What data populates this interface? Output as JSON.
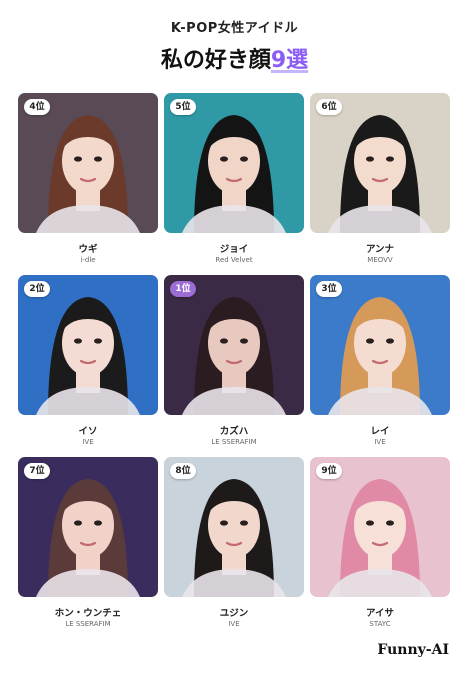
{
  "header": {
    "subtitle": "K-POP女性アイドル",
    "title_main": "私の好き顔",
    "title_accent": "9選"
  },
  "cards": [
    {
      "rank": "4位",
      "name": "ウギ",
      "group": "i-dle",
      "bg": "#5a4a55",
      "hair": "#6b3a2a",
      "skin": "#f2d9cc"
    },
    {
      "rank": "5位",
      "name": "ジョイ",
      "group": "Red Velvet",
      "bg": "#2f9aa6",
      "hair": "#141414",
      "skin": "#f1d6c8"
    },
    {
      "rank": "6位",
      "name": "アンナ",
      "group": "MEOVV",
      "bg": "#d9d2c6",
      "hair": "#1a1a1a",
      "skin": "#f3dccd"
    },
    {
      "rank": "2位",
      "name": "イソ",
      "group": "IVE",
      "bg": "#2f6fc4",
      "hair": "#1b1b1b",
      "skin": "#f4dcd4"
    },
    {
      "rank": "1位",
      "name": "カズハ",
      "group": "LE SSERAFIM",
      "bg": "#3a2a45",
      "hair": "#2a1c20",
      "skin": "#e8c9c0"
    },
    {
      "rank": "3位",
      "name": "レイ",
      "group": "IVE",
      "bg": "#3b7bc9",
      "hair": "#d59a5a",
      "skin": "#f4ddd0"
    },
    {
      "rank": "7位",
      "name": "ホン・ウンチェ",
      "group": "LE SSERAFIM",
      "bg": "#3a2d5e",
      "hair": "#5b3a3a",
      "skin": "#f0d2c8"
    },
    {
      "rank": "8位",
      "name": "ユジン",
      "group": "IVE",
      "bg": "#c9d3dc",
      "hair": "#1e1a1a",
      "skin": "#f2d8cc"
    },
    {
      "rank": "9位",
      "name": "アイサ",
      "group": "STAYC",
      "bg": "#e9c2cf",
      "hair": "#e08aa6",
      "skin": "#f6e0d8"
    }
  ],
  "footer": {
    "brand": "Funny-AI"
  }
}
